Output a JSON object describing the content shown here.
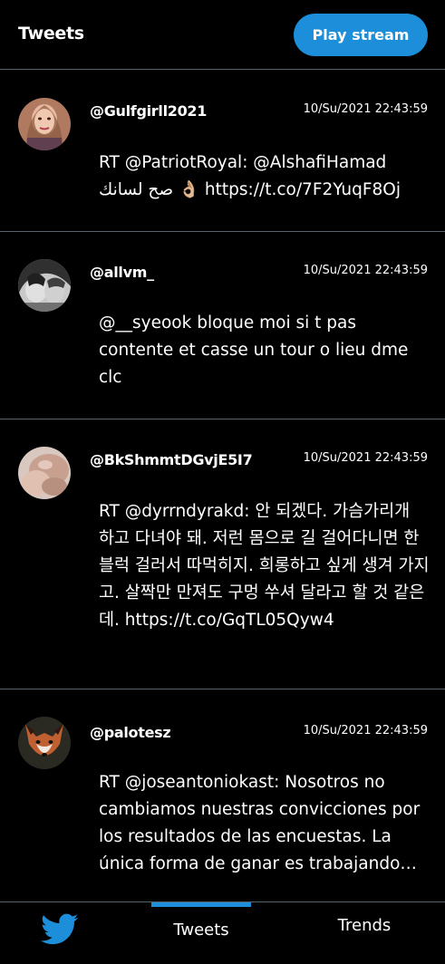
{
  "header": {
    "title": "Tweets",
    "play_button_label": "Play stream"
  },
  "tweets": [
    {
      "handle": "@Gulfgirll2021",
      "timestamp": "10/Su/2021 22:43:59",
      "text_line1": "RT @PatriotRoyal: @AlshafiHamad",
      "text_line2_rtl": "صح لسانك",
      "text_line2_emoji": "👌🏼",
      "text_line2_link": "https://t.co/7F2YuqF8Oj"
    },
    {
      "handle": "@allvm_",
      "timestamp": "10/Su/2021 22:43:59",
      "text": "@__syeook bloque moi si t pas contente et casse un tour o lieu dme clc"
    },
    {
      "handle": "@BkShmmtDGvjE5I7",
      "timestamp": "10/Su/2021 22:43:59",
      "text": "RT @dyrrndyrakd: 안 되겠다. 가슴가리개 하고 다녀야 돼. 저런 몸으로 길 걸어다니면 한 블럭 걸러서 따먹히지. 희롱하고 싶게 생겨 가지고. 살짝만 만져도 구멍 쑤셔 달라고 할 것 같은데. https://t.co/GqTL05Qyw4"
    },
    {
      "handle": "@palotesz",
      "timestamp": "10/Su/2021 22:43:59",
      "text": "RT @joseantoniokast: Nosotros no cambiamos nuestras convicciones por los resultados de las encuestas. La única forma de ganar es trabajando…"
    }
  ],
  "bottom_nav": {
    "home_icon": "twitter-bird-icon",
    "tweets_label": "Tweets",
    "trends_label": "Trends"
  },
  "colors": {
    "accent": "#1d8ed9",
    "background": "#000000",
    "divider": "#5a6470"
  }
}
